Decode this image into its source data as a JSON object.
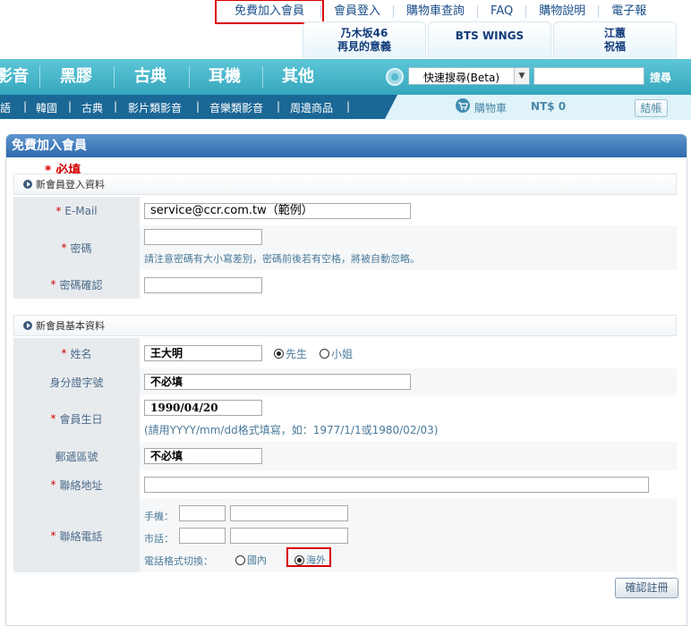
{
  "top_links": [
    "免費加入會員",
    "會員登入",
    "購物車查詢",
    "FAQ",
    "購物說明",
    "電子報"
  ],
  "promos": [
    {
      "line1": "乃木坂46",
      "line2": "再見的意義"
    },
    {
      "line1": "BTS WINGS",
      "line2": ""
    },
    {
      "line1": "江蕙",
      "line2": "祝福"
    }
  ],
  "main_nav": [
    "影音",
    "黑膠",
    "古典",
    "耳機",
    "其他"
  ],
  "search": {
    "selected": "快速搜尋(Beta)",
    "value": "",
    "button": "搜尋"
  },
  "sub_nav": [
    "語",
    "韓國",
    "古典",
    "影片類影音",
    "音樂類影音",
    "周邊商品"
  ],
  "cart": {
    "label": "購物車",
    "amount": "NT$ 0",
    "checkout": "結帳"
  },
  "panel_title": "免費加入會員",
  "required_note": "* 必填",
  "section1": {
    "title": "新會員登入資料",
    "email_label": "E-Mail",
    "email_value": "service@ccr.com.tw（範例）",
    "password_label": "密碼",
    "password_value": "",
    "password_hint": "請注意密碼有大小寫差別，密碼前後若有空格，將被自動忽略。",
    "confirm_label": "密碼確認",
    "confirm_value": ""
  },
  "section2": {
    "title": "新會員基本資料",
    "name_label": "姓名",
    "name_value": "王大明",
    "mr": "先生",
    "ms": "小姐",
    "id_label": "身分證字號",
    "id_value": "不必填",
    "birthday_label": "會員生日",
    "birthday_value": "1990/04/20",
    "birthday_hint": "(請用YYYY/mm/dd格式填寫，如：1977/1/1或1980/02/03)",
    "zip_label": "郵遞區號",
    "zip_value": "不必填",
    "address_label": "聯絡地址",
    "address_value": "",
    "phone_label": "聯絡電話",
    "mobile_label": "手機：",
    "tel_label": "市話：",
    "format_label": "電話格式切換：",
    "domestic": "國內",
    "overseas": "海外"
  },
  "submit": "確認註冊",
  "colors": {
    "accent_red": "#d90000",
    "nav_teal": "#35a7be",
    "subnav_blue": "#1b6796",
    "panel_blue": "#2f6aad"
  }
}
